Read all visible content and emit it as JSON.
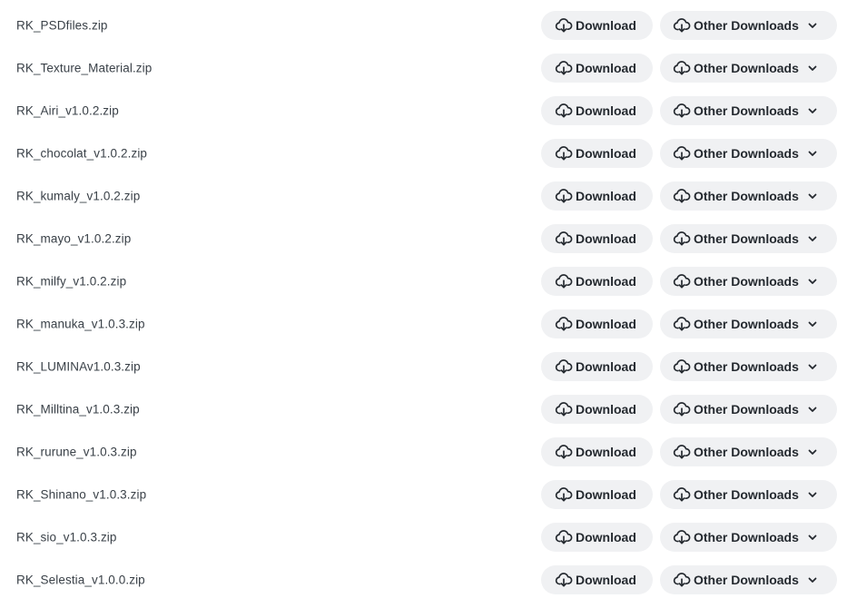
{
  "files": [
    {
      "name": "RK_PSDfiles.zip"
    },
    {
      "name": "RK_Texture_Material.zip"
    },
    {
      "name": "RK_Airi_v1.0.2.zip"
    },
    {
      "name": "RK_chocolat_v1.0.2.zip"
    },
    {
      "name": "RK_kumaly_v1.0.2.zip"
    },
    {
      "name": "RK_mayo_v1.0.2.zip"
    },
    {
      "name": "RK_milfy_v1.0.2.zip"
    },
    {
      "name": "RK_manuka_v1.0.3.zip"
    },
    {
      "name": "RK_LUMINAv1.0.3.zip"
    },
    {
      "name": "RK_Milltina_v1.0.3.zip"
    },
    {
      "name": "RK_rurune_v1.0.3.zip"
    },
    {
      "name": "RK_Shinano_v1.0.3.zip"
    },
    {
      "name": "RK_sio_v1.0.3.zip"
    },
    {
      "name": "RK_Selestia_v1.0.0.zip"
    }
  ],
  "labels": {
    "download": "Download",
    "other_downloads": "Other Downloads"
  },
  "icons": {
    "download": "cloud-download-icon",
    "dropdown": "chevron-down-icon"
  },
  "colors": {
    "button_bg": "#f0f1f3",
    "button_text": "#24292f",
    "file_text": "#3a4148"
  }
}
